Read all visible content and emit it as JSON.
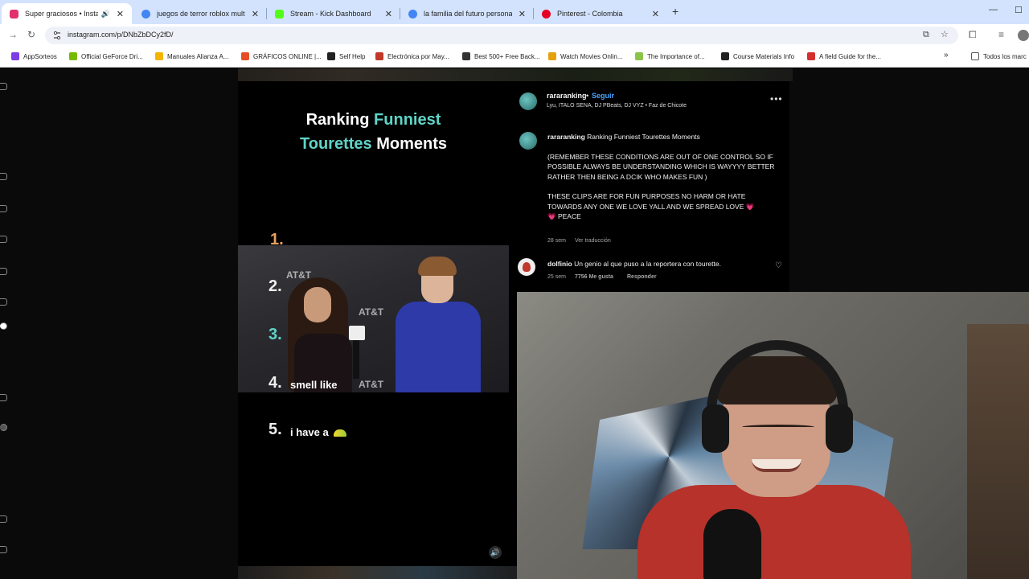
{
  "browser": {
    "tabs": [
      {
        "title": "Super graciosos • Instagram",
        "active": true,
        "favicon_color": "#e1306c",
        "audio": true
      },
      {
        "title": "juegos de terror roblox multijug",
        "active": false,
        "favicon_color": "#4285f4"
      },
      {
        "title": "Stream - Kick Dashboard",
        "active": false,
        "favicon_color": "#53fc18"
      },
      {
        "title": "la familia del futuro personajes",
        "active": false,
        "favicon_color": "#4285f4"
      },
      {
        "title": "Pinterest - Colombia",
        "active": false,
        "favicon_color": "#e60023"
      }
    ],
    "new_tab_label": "+",
    "url": "instagram.com/p/DNbZbDCy2fD/",
    "bookmarks": [
      {
        "label": "AppSorteos",
        "color": "#7b3fe4"
      },
      {
        "label": "Official GeForce Dri...",
        "color": "#76b900"
      },
      {
        "label": "Manuales Alianza A...",
        "color": "#f4b400"
      },
      {
        "label": "GRÁFICOS ONLINE |...",
        "color": "#e44d26"
      },
      {
        "label": "Self Help",
        "color": "#222222"
      },
      {
        "label": "Electrónica por May...",
        "color": "#c0392b"
      },
      {
        "label": "Best 500+ Free Back...",
        "color": "#333333"
      },
      {
        "label": "Watch Movies Onlin...",
        "color": "#e5a00d"
      },
      {
        "label": "The Importance of...",
        "color": "#8bc34a"
      },
      {
        "label": "Course Materials Info",
        "color": "#222222"
      },
      {
        "label": "A field Guide for the...",
        "color": "#d32f2f"
      }
    ],
    "all_bookmarks_label": "Todos los marc"
  },
  "video": {
    "title_white_1": "Ranking ",
    "title_teal_1": "Funniest",
    "title_teal_2": "Tourettes",
    "title_white_2": " Moments",
    "rank_1": "1.",
    "rank_2": "2.",
    "rank_3": "3.",
    "rank_4": "4.",
    "rank_4_text": "smell like",
    "rank_5": "5.",
    "rank_5_text": "i have a",
    "clip_logo": "AT&T",
    "mute_icon": "speaker-icon"
  },
  "post": {
    "username": "rararanking",
    "follow_label": "Seguir",
    "separator": "•",
    "audio_line": "Lyu, ITALO SENA, DJ PBeats, DJ VYZ • Faz de Chicote",
    "more_label": "•••",
    "caption_user": "rararanking",
    "caption_title": "Ranking Funniest Tourettes Moments",
    "caption_p1": "(REMEMBER THESE CONDITIONS ARE OUT OF ONE CONTROL SO IF POSSIBLE ALWAYS BE UNDERSTANDING WHICH IS WAYYYY BETTER RATHER THEN BEING A DCIK WHO MAKES FUN )",
    "caption_p2": "THESE CLIPS ARE FOR FUN PURPOSES NO HARM OR HATE TOWARDS ANY ONE WE LOVE YALL AND WE SPREAD LOVE",
    "caption_p2_end": "PEACE",
    "caption_age": "28 sem",
    "see_translation": "Ver traducción",
    "comment": {
      "user": "dolfinio",
      "text": "Un genio al que puso a la reportera con tourette.",
      "age": "25 sem",
      "likes": "7756 Me gusta",
      "reply_label": "Responder"
    }
  }
}
